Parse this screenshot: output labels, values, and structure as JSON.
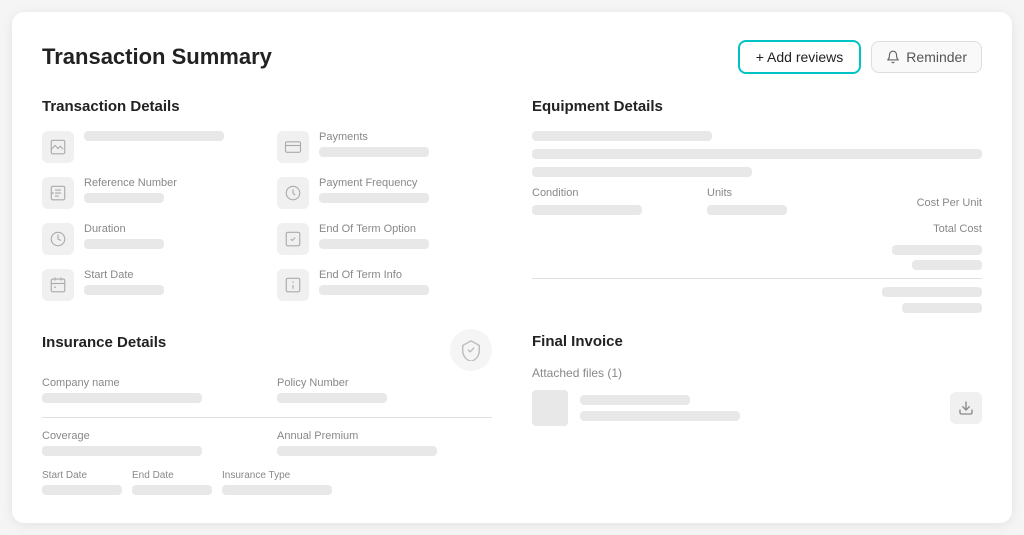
{
  "page": {
    "title": "Transaction Summary"
  },
  "header": {
    "add_reviews_label": "+ Add reviews",
    "reminder_label": "Reminder"
  },
  "transaction_details": {
    "section_title": "Transaction Details",
    "items": [
      {
        "label": "",
        "icon": "image-icon"
      },
      {
        "label": "Payments",
        "icon": "payments-icon"
      },
      {
        "label": "Reference Number",
        "icon": "reference-icon"
      },
      {
        "label": "Payment Frequency",
        "icon": "frequency-icon"
      },
      {
        "label": "Duration",
        "icon": "duration-icon"
      },
      {
        "label": "End Of Term Option",
        "icon": "end-term-icon"
      },
      {
        "label": "Start Date",
        "icon": "start-date-icon"
      },
      {
        "label": "End Of Term Info",
        "icon": "end-info-icon"
      }
    ]
  },
  "insurance_details": {
    "section_title": "Insurance Details",
    "company_name_label": "Company name",
    "policy_number_label": "Policy Number",
    "coverage_label": "Coverage",
    "annual_premium_label": "Annual Premium",
    "start_date_label": "Start Date",
    "end_date_label": "End Date",
    "insurance_type_label": "Insurance Type"
  },
  "equipment_details": {
    "section_title": "Equipment Details",
    "condition_label": "Condition",
    "units_label": "Units",
    "cost_per_unit_label": "Cost Per Unit",
    "total_cost_label": "Total Cost"
  },
  "final_invoice": {
    "section_title": "Final Invoice",
    "attached_files_label": "Attached files (1)"
  },
  "colors": {
    "teal": "#00c4c4",
    "skeleton": "#e8e8e8"
  }
}
